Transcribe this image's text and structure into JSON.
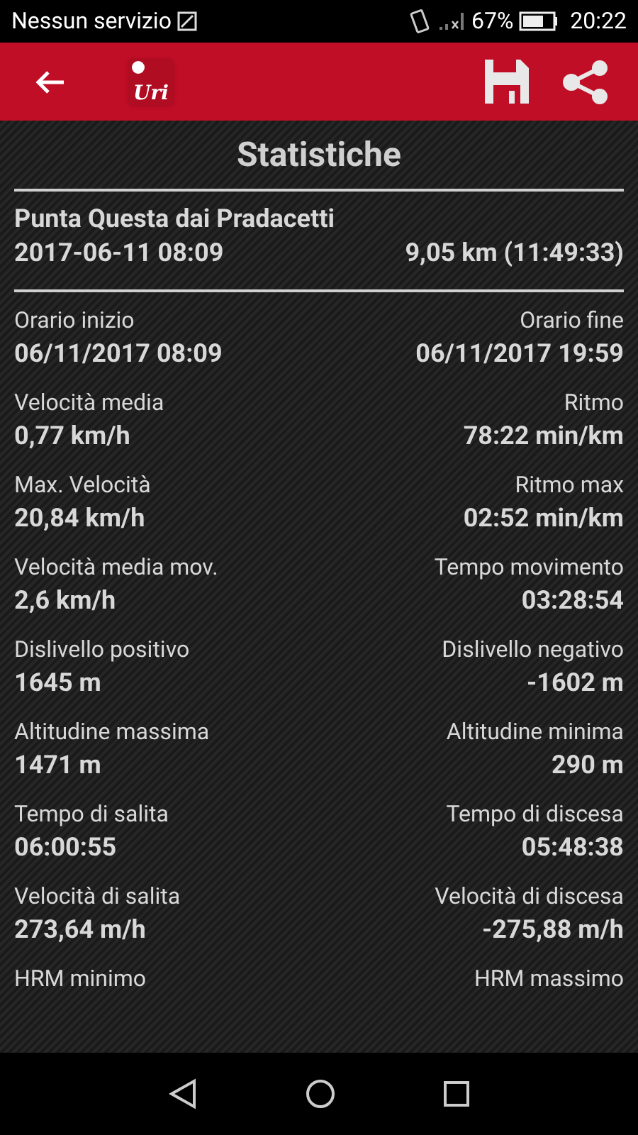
{
  "status_bar": {
    "carrier": "Nessun servizio",
    "battery": "67%",
    "time": "20:22"
  },
  "toolbar": {
    "logo_text": "Uri"
  },
  "title": "Statistiche",
  "track": {
    "name": "Punta Questa dai Pradacetti",
    "date": "2017-06-11 08:09",
    "summary": "9,05 km (11:49:33)"
  },
  "stats": [
    {
      "left_label": "Orario inizio",
      "left_value": "06/11/2017 08:09",
      "right_label": "Orario fine",
      "right_value": "06/11/2017 19:59"
    },
    {
      "left_label": "Velocità media",
      "left_value": "0,77 km/h",
      "right_label": "Ritmo",
      "right_value": "78:22 min/km"
    },
    {
      "left_label": "Max. Velocità",
      "left_value": "20,84 km/h",
      "right_label": "Ritmo max",
      "right_value": "02:52 min/km"
    },
    {
      "left_label": "Velocità media mov.",
      "left_value": "2,6 km/h",
      "right_label": "Tempo movimento",
      "right_value": "03:28:54"
    },
    {
      "left_label": "Dislivello positivo",
      "left_value": "1645 m",
      "right_label": "Dislivello negativo",
      "right_value": "-1602 m"
    },
    {
      "left_label": "Altitudine massima",
      "left_value": "1471 m",
      "right_label": "Altitudine minima",
      "right_value": "290 m"
    },
    {
      "left_label": "Tempo di salita",
      "left_value": "06:00:55",
      "right_label": "Tempo di discesa",
      "right_value": "05:48:38"
    },
    {
      "left_label": "Velocità di salita",
      "left_value": "273,64 m/h",
      "right_label": "Velocità di discesa",
      "right_value": "-275,88 m/h"
    },
    {
      "left_label": "HRM minimo",
      "right_label": "HRM massimo"
    }
  ]
}
